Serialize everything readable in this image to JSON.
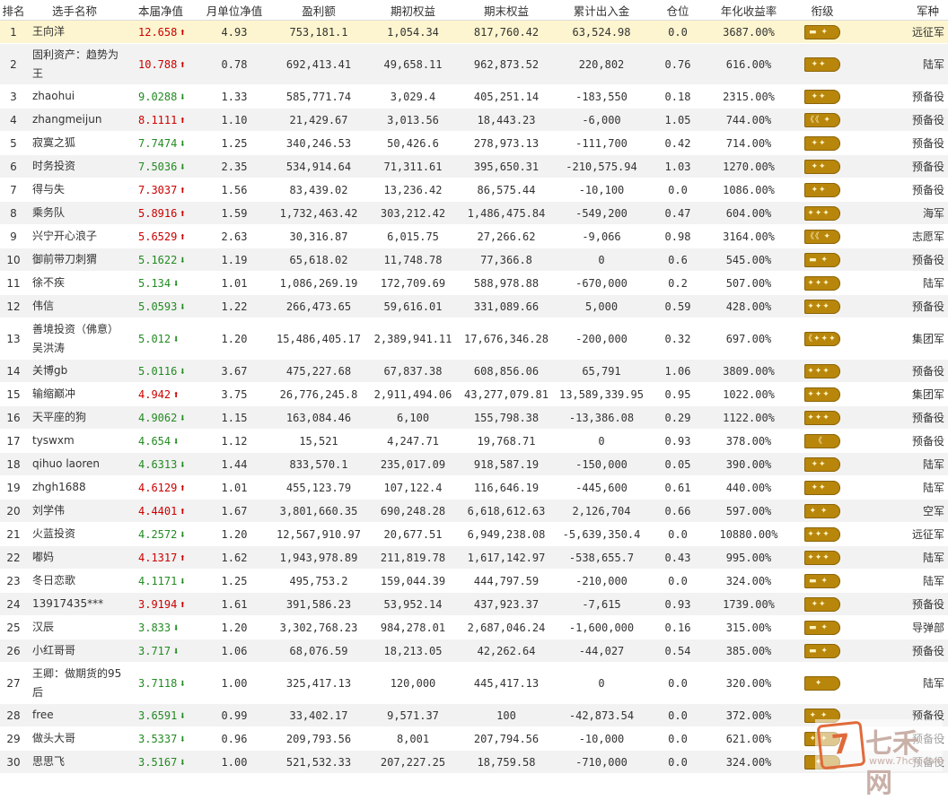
{
  "headers": [
    "排名",
    "选手名称",
    "本届净值",
    "月单位净值",
    "盈利额",
    "期初权益",
    "期末权益",
    "累计出入金",
    "仓位",
    "年化收益率",
    "衔级",
    "军种"
  ],
  "rows": [
    {
      "rank": "1",
      "name": "王向洋",
      "nav": "12.658",
      "dir": "up",
      "month": "4.93",
      "profit": "753,181.1",
      "start": "1,054.34",
      "end": "817,760.42",
      "cum": "63,524.98",
      "pos": "0.0",
      "annual": "3687.00%",
      "badge": "▬ ✦",
      "branch": "远征军"
    },
    {
      "rank": "2",
      "name": "固利资产：趋势为王",
      "nav": "10.788",
      "dir": "up",
      "month": "0.78",
      "profit": "692,413.41",
      "start": "49,658.11",
      "end": "962,873.52",
      "cum": "220,802",
      "pos": "0.76",
      "annual": "616.00%",
      "badge": "✦✦",
      "branch": "陆军"
    },
    {
      "rank": "3",
      "name": "zhaohui",
      "nav": "9.0288",
      "dir": "down",
      "month": "1.33",
      "profit": "585,771.74",
      "start": "3,029.4",
      "end": "405,251.14",
      "cum": "-183,550",
      "pos": "0.18",
      "annual": "2315.00%",
      "badge": "✦✦",
      "branch": "预备役"
    },
    {
      "rank": "4",
      "name": "zhangmeijun",
      "nav": "8.1111",
      "dir": "up",
      "month": "1.10",
      "profit": "21,429.67",
      "start": "3,013.56",
      "end": "18,443.23",
      "cum": "-6,000",
      "pos": "1.05",
      "annual": "744.00%",
      "badge": "《《 ✦",
      "branch": "预备役"
    },
    {
      "rank": "5",
      "name": "寂寞之狐",
      "nav": "7.7474",
      "dir": "down",
      "month": "1.25",
      "profit": "340,246.53",
      "start": "50,426.6",
      "end": "278,973.13",
      "cum": "-111,700",
      "pos": "0.42",
      "annual": "714.00%",
      "badge": "✦✦",
      "branch": "预备役"
    },
    {
      "rank": "6",
      "name": "时务投资",
      "nav": "7.5036",
      "dir": "down",
      "month": "2.35",
      "profit": "534,914.64",
      "start": "71,311.61",
      "end": "395,650.31",
      "cum": "-210,575.94",
      "pos": "1.03",
      "annual": "1270.00%",
      "badge": "✦✦",
      "branch": "预备役"
    },
    {
      "rank": "7",
      "name": "得与失",
      "nav": "7.3037",
      "dir": "up",
      "month": "1.56",
      "profit": "83,439.02",
      "start": "13,236.42",
      "end": "86,575.44",
      "cum": "-10,100",
      "pos": "0.0",
      "annual": "1086.00%",
      "badge": "✦✦",
      "branch": "预备役"
    },
    {
      "rank": "8",
      "name": "乘务队",
      "nav": "5.8916",
      "dir": "up",
      "month": "1.59",
      "profit": "1,732,463.42",
      "start": "303,212.42",
      "end": "1,486,475.84",
      "cum": "-549,200",
      "pos": "0.47",
      "annual": "604.00%",
      "badge": "✦✦✦",
      "branch": "海军"
    },
    {
      "rank": "9",
      "name": "兴宁开心浪子",
      "nav": "5.6529",
      "dir": "up",
      "month": "2.63",
      "profit": "30,316.87",
      "start": "6,015.75",
      "end": "27,266.62",
      "cum": "-9,066",
      "pos": "0.98",
      "annual": "3164.00%",
      "badge": "《《 ✦",
      "branch": "志愿军"
    },
    {
      "rank": "10",
      "name": "御前带刀刺猬",
      "nav": "5.1622",
      "dir": "down",
      "month": "1.19",
      "profit": "65,618.02",
      "start": "11,748.78",
      "end": "77,366.8",
      "cum": "0",
      "pos": "0.6",
      "annual": "545.00%",
      "badge": "▬ ✦",
      "branch": "预备役"
    },
    {
      "rank": "11",
      "name": "徐不疾",
      "nav": "5.134",
      "dir": "down",
      "month": "1.01",
      "profit": "1,086,269.19",
      "start": "172,709.69",
      "end": "588,978.88",
      "cum": "-670,000",
      "pos": "0.2",
      "annual": "507.00%",
      "badge": "✦✦✦",
      "branch": "陆军"
    },
    {
      "rank": "12",
      "name": "伟信",
      "nav": "5.0593",
      "dir": "down",
      "month": "1.22",
      "profit": "266,473.65",
      "start": "59,616.01",
      "end": "331,089.66",
      "cum": "5,000",
      "pos": "0.59",
      "annual": "428.00%",
      "badge": "✦✦✦",
      "branch": "预备役"
    },
    {
      "rank": "13",
      "name": "善境投资（佛意）吴洪涛",
      "nav": "5.012",
      "dir": "down",
      "month": "1.20",
      "profit": "15,486,405.17",
      "start": "2,389,941.11",
      "end": "17,676,346.28",
      "cum": "-200,000",
      "pos": "0.32",
      "annual": "697.00%",
      "badge": "《✦✦✦",
      "branch": "集团军"
    },
    {
      "rank": "14",
      "name": "关博gb",
      "nav": "5.0116",
      "dir": "down",
      "month": "3.67",
      "profit": "475,227.68",
      "start": "67,837.38",
      "end": "608,856.06",
      "cum": "65,791",
      "pos": "1.06",
      "annual": "3809.00%",
      "badge": "✦✦✦",
      "branch": "预备役"
    },
    {
      "rank": "15",
      "name": "输缩巅冲",
      "nav": "4.942",
      "dir": "up",
      "month": "3.75",
      "profit": "26,776,245.8",
      "start": "2,911,494.06",
      "end": "43,277,079.81",
      "cum": "13,589,339.95",
      "pos": "0.95",
      "annual": "1022.00%",
      "badge": "✦✦✦",
      "branch": "集团军"
    },
    {
      "rank": "16",
      "name": "天平座的狗",
      "nav": "4.9062",
      "dir": "down",
      "month": "1.15",
      "profit": "163,084.46",
      "start": "6,100",
      "end": "155,798.38",
      "cum": "-13,386.08",
      "pos": "0.29",
      "annual": "1122.00%",
      "badge": "✦✦✦",
      "branch": "预备役"
    },
    {
      "rank": "17",
      "name": "tyswxm",
      "nav": "4.654",
      "dir": "down",
      "month": "1.12",
      "profit": "15,521",
      "start": "4,247.71",
      "end": "19,768.71",
      "cum": "0",
      "pos": "0.93",
      "annual": "378.00%",
      "badge": "《",
      "branch": "预备役"
    },
    {
      "rank": "18",
      "name": "qihuo laoren",
      "nav": "4.6313",
      "dir": "down",
      "month": "1.44",
      "profit": "833,570.1",
      "start": "235,017.09",
      "end": "918,587.19",
      "cum": "-150,000",
      "pos": "0.05",
      "annual": "390.00%",
      "badge": "✦✦",
      "branch": "陆军"
    },
    {
      "rank": "19",
      "name": "zhgh1688",
      "nav": "4.6129",
      "dir": "up",
      "month": "1.01",
      "profit": "455,123.79",
      "start": "107,122.4",
      "end": "116,646.19",
      "cum": "-445,600",
      "pos": "0.61",
      "annual": "440.00%",
      "badge": "✦✦",
      "branch": "陆军"
    },
    {
      "rank": "20",
      "name": "刘学伟",
      "nav": "4.4401",
      "dir": "up",
      "month": "1.67",
      "profit": "3,801,660.35",
      "start": "690,248.28",
      "end": "6,618,612.63",
      "cum": "2,126,704",
      "pos": "0.66",
      "annual": "597.00%",
      "badge": "✦ ✦",
      "branch": "空军"
    },
    {
      "rank": "21",
      "name": "火蓝投资",
      "nav": "4.2572",
      "dir": "down",
      "month": "1.20",
      "profit": "12,567,910.97",
      "start": "20,677.51",
      "end": "6,949,238.08",
      "cum": "-5,639,350.4",
      "pos": "0.0",
      "annual": "10880.00%",
      "badge": "✦✦✦",
      "branch": "远征军"
    },
    {
      "rank": "22",
      "name": "嘟妈",
      "nav": "4.1317",
      "dir": "up",
      "month": "1.62",
      "profit": "1,943,978.89",
      "start": "211,819.78",
      "end": "1,617,142.97",
      "cum": "-538,655.7",
      "pos": "0.43",
      "annual": "995.00%",
      "badge": "✦✦✦",
      "branch": "陆军"
    },
    {
      "rank": "23",
      "name": "冬日恋歌",
      "nav": "4.1171",
      "dir": "down",
      "month": "1.25",
      "profit": "495,753.2",
      "start": "159,044.39",
      "end": "444,797.59",
      "cum": "-210,000",
      "pos": "0.0",
      "annual": "324.00%",
      "badge": "▬ ✦",
      "branch": "陆军"
    },
    {
      "rank": "24",
      "name": "13917435***",
      "nav": "3.9194",
      "dir": "up",
      "month": "1.61",
      "profit": "391,586.23",
      "start": "53,952.14",
      "end": "437,923.37",
      "cum": "-7,615",
      "pos": "0.93",
      "annual": "1739.00%",
      "badge": "✦✦",
      "branch": "预备役"
    },
    {
      "rank": "25",
      "name": "汉辰",
      "nav": "3.833",
      "dir": "down",
      "month": "1.20",
      "profit": "3,302,768.23",
      "start": "984,278.01",
      "end": "2,687,046.24",
      "cum": "-1,600,000",
      "pos": "0.16",
      "annual": "315.00%",
      "badge": "▬ ✦",
      "branch": "导弹部"
    },
    {
      "rank": "26",
      "name": "小红哥哥",
      "nav": "3.717",
      "dir": "down",
      "month": "1.06",
      "profit": "68,076.59",
      "start": "18,213.05",
      "end": "42,262.64",
      "cum": "-44,027",
      "pos": "0.54",
      "annual": "385.00%",
      "badge": "▬ ✦",
      "branch": "预备役"
    },
    {
      "rank": "27",
      "name": "王卿：做期货的95后",
      "nav": "3.7118",
      "dir": "down",
      "month": "1.00",
      "profit": "325,417.13",
      "start": "120,000",
      "end": "445,417.13",
      "cum": "0",
      "pos": "0.0",
      "annual": "320.00%",
      "badge": "✦",
      "branch": "陆军"
    },
    {
      "rank": "28",
      "name": "free",
      "nav": "3.6591",
      "dir": "down",
      "month": "0.99",
      "profit": "33,402.17",
      "start": "9,571.37",
      "end": "100",
      "cum": "-42,873.54",
      "pos": "0.0",
      "annual": "372.00%",
      "badge": "✦ ✦",
      "branch": "预备役"
    },
    {
      "rank": "29",
      "name": "做头大哥",
      "nav": "3.5337",
      "dir": "down",
      "month": "0.96",
      "profit": "209,793.56",
      "start": "8,001",
      "end": "207,794.56",
      "cum": "-10,000",
      "pos": "0.0",
      "annual": "621.00%",
      "badge": "✦ ✦",
      "branch": "预备役"
    },
    {
      "rank": "30",
      "name": "思思飞",
      "nav": "3.5167",
      "dir": "down",
      "month": "1.00",
      "profit": "521,532.33",
      "start": "207,227.25",
      "end": "18,759.58",
      "cum": "-710,000",
      "pos": "0.0",
      "annual": "324.00%",
      "badge": "✦",
      "branch": "预备役"
    }
  ],
  "watermark": {
    "logo": "7",
    "text": "七禾网",
    "url": "www.7hcn.com"
  },
  "colors": {
    "up": "#cc0000",
    "down": "#228b22",
    "badge": "#b8860b",
    "highlight": "#fdf5cf",
    "stripe": "#f2f2f2"
  }
}
